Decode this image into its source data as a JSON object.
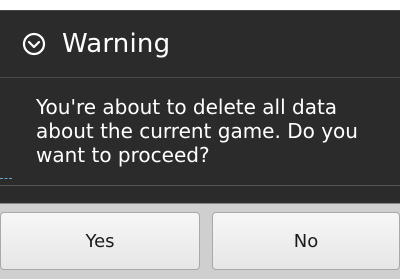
{
  "dialog": {
    "title": "Warning",
    "icon": "warning-circle-chevron-icon",
    "message": "You're about to delete all data about the current game. Do you want to proceed?",
    "buttons": {
      "yes_label": "Yes",
      "no_label": "No"
    }
  },
  "colors": {
    "dialog_background": "#2b2b2b",
    "title_text": "#ffffff",
    "button_bar": "#cfcfcf",
    "button_text": "#1a1a1a"
  }
}
